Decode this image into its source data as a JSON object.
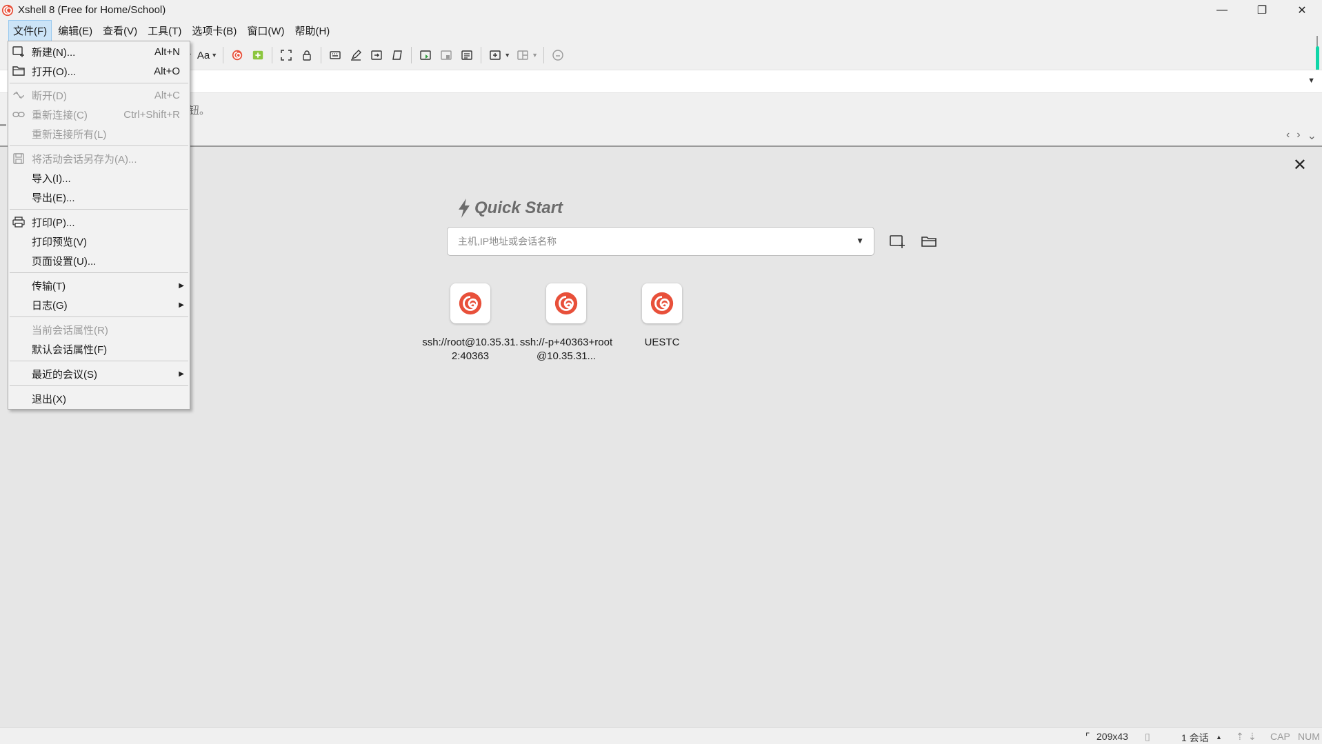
{
  "window": {
    "title": "Xshell 8 (Free for Home/School)",
    "minimize": "—",
    "restore": "❐",
    "close": "✕"
  },
  "menubar": {
    "items": [
      "文件(F)",
      "编辑(E)",
      "查看(V)",
      "工具(T)",
      "选项卡(B)",
      "窗口(W)",
      "帮助(H)"
    ]
  },
  "toolbar": {
    "font_label": "Aa"
  },
  "hint": {
    "text": "钮。"
  },
  "file_menu": {
    "new": {
      "label": "新建(N)...",
      "shortcut": "Alt+N"
    },
    "open": {
      "label": "打开(O)...",
      "shortcut": "Alt+O"
    },
    "disconnect": {
      "label": "断开(D)",
      "shortcut": "Alt+C"
    },
    "reconnect": {
      "label": "重新连接(C)",
      "shortcut": "Ctrl+Shift+R"
    },
    "reconnect_all": {
      "label": "重新连接所有(L)"
    },
    "save_as": {
      "label": "将活动会话另存为(A)..."
    },
    "import": {
      "label": "导入(I)..."
    },
    "export": {
      "label": "导出(E)..."
    },
    "print": {
      "label": "打印(P)..."
    },
    "print_preview": {
      "label": "打印预览(V)"
    },
    "page_setup": {
      "label": "页面设置(U)..."
    },
    "transfer": {
      "label": "传输(T)"
    },
    "log": {
      "label": "日志(G)"
    },
    "current_props": {
      "label": "当前会话属性(R)"
    },
    "default_props": {
      "label": "默认会话属性(F)"
    },
    "recent": {
      "label": "最近的会议(S)"
    },
    "exit": {
      "label": "退出(X)"
    }
  },
  "quick_start": {
    "title": "Quick Start",
    "placeholder": "主机,IP地址或会话名称",
    "sessions": [
      {
        "label": "ssh://root@10.35.31.2:40363"
      },
      {
        "label": "ssh://-p+40363+root@10.35.31..."
      },
      {
        "label": "UESTC"
      }
    ]
  },
  "statusbar": {
    "size": "209x43",
    "sessions": "1 会话",
    "cap": "CAP",
    "num": "NUM"
  },
  "colors": {
    "accent": "#e8503a",
    "scroll_accent": "#10d6a8",
    "menu_highlight": "#cce4f7"
  }
}
